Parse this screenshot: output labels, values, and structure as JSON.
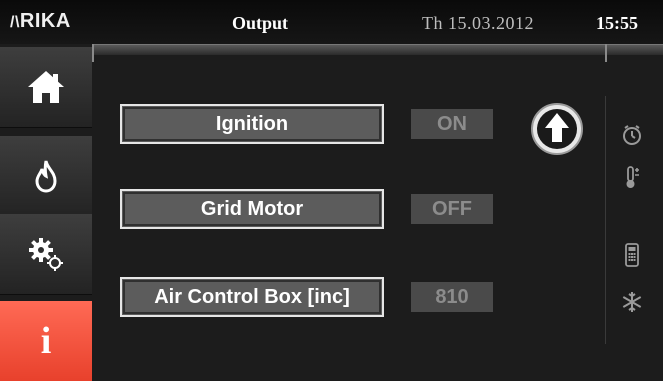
{
  "header": {
    "logo": "RIKA",
    "title": "Output",
    "date": "Th 15.03.2012",
    "time": "15:55"
  },
  "nav": [
    {
      "id": "home",
      "icon": "home-icon",
      "active": false
    },
    {
      "id": "flame",
      "icon": "flame-icon",
      "active": false
    },
    {
      "id": "settings",
      "icon": "gears-icon",
      "active": false
    },
    {
      "id": "info",
      "icon": "info-icon",
      "label": "i",
      "active": true
    }
  ],
  "outputs": [
    {
      "label": "Ignition",
      "value": "ON"
    },
    {
      "label": "Grid Motor",
      "value": "OFF"
    },
    {
      "label": "Air Control Box [inc]",
      "value": "810"
    }
  ],
  "side_icons": [
    "clock-icon",
    "thermometer-icon",
    "remote-icon",
    "snowflake-icon"
  ],
  "colors": {
    "accent": "#e8412c",
    "background": "#1c1c1c",
    "box_fill": "#5c5c5c",
    "value_text": "#8c8c8c"
  }
}
